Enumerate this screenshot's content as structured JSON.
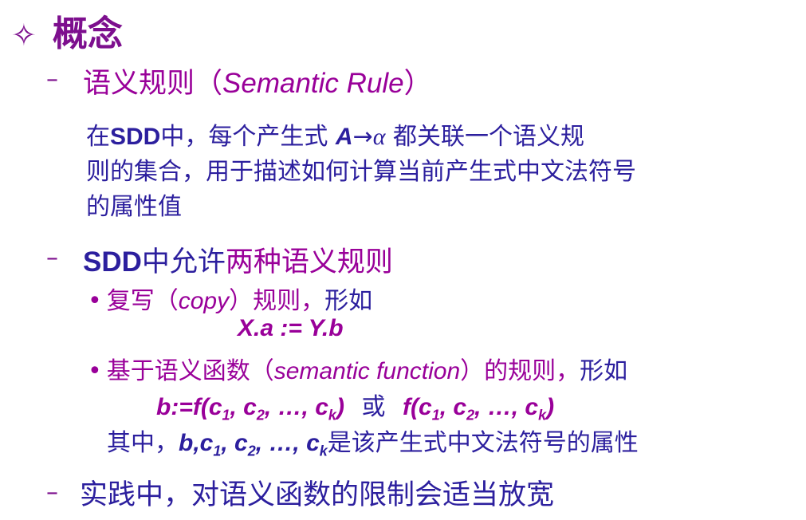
{
  "title": {
    "bullet_symbol": "✧",
    "text": "概念"
  },
  "section1": {
    "dash": "–",
    "heading_main": "语义规则（",
    "heading_en": "Semantic Rule",
    "heading_close": "）",
    "para_line1_a": "在",
    "para_line1_sdd": "SDD",
    "para_line1_b": "中，每个产生式 ",
    "para_line1_A": "A",
    "para_line1_arrow": "→",
    "para_line1_alpha": "α",
    "para_line1_c": " 都关联一个语义规",
    "para_line2": "则的集合，用于描述如何计算当前产生式中文法符号",
    "para_line3": "的属性值"
  },
  "section2": {
    "dash": "–",
    "heading_sdd": "SDD",
    "heading_mid": "中允许",
    "heading_end": "两种语义规则",
    "bullet1": {
      "dot": "•",
      "text_a": "复写（",
      "text_en": "copy",
      "text_b": "）规则，",
      "text_c": "形如",
      "formula": "X.a := Y.b"
    },
    "bullet2": {
      "dot": "•",
      "text_a": "基于语义函数（",
      "text_en": "semantic function",
      "text_b": "）的规则，",
      "text_c": "形如",
      "formula_a_prefix": "b:=f(c",
      "formula_sub1": "1",
      "formula_sep1": ", c",
      "formula_sub2": "2",
      "formula_sep2": ", …, c",
      "formula_subk": "k",
      "formula_close": ")",
      "or_word": "或",
      "formula_b_prefix": "f(c",
      "formula_b_sub1": "1",
      "formula_b_sep1": ", c",
      "formula_b_sub2": "2",
      "formula_b_sep2": ", …, c",
      "formula_b_subk": "k",
      "formula_b_close": ")",
      "where_a": "其中，",
      "where_bold_a": "b,c",
      "where_sub1": "1",
      "where_sep1": ", c",
      "where_sub2": "2",
      "where_sep2": ", …, c",
      "where_subk": "k",
      "where_b": "是该产生式中文法符号的属性"
    }
  },
  "section3": {
    "dash": "–",
    "text": "实践中，对语义函数的限制会适当放宽"
  }
}
